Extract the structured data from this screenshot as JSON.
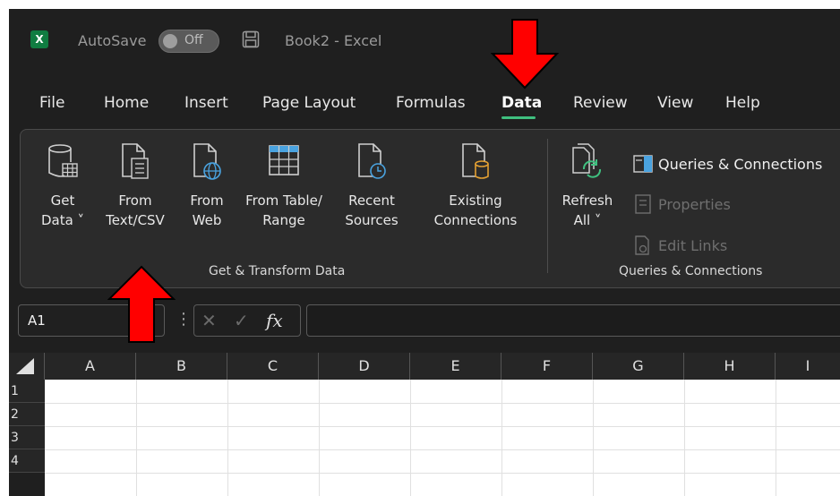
{
  "titlebar": {
    "logo": "X",
    "autosave_label": "AutoSave",
    "autosave_state": "Off",
    "save_icon": "save-icon",
    "doc_title": "Book2 - Excel"
  },
  "tabs": [
    {
      "label": "File"
    },
    {
      "label": "Home"
    },
    {
      "label": "Insert"
    },
    {
      "label": "Page Layout"
    },
    {
      "label": "Formulas"
    },
    {
      "label": "Data"
    },
    {
      "label": "Review"
    },
    {
      "label": "View"
    },
    {
      "label": "Help"
    }
  ],
  "active_tab": "Data",
  "ribbon": {
    "get_transform": {
      "group_label": "Get & Transform Data",
      "buttons": [
        {
          "line1": "Get",
          "line2": "Data ˅",
          "icon": "database-icon"
        },
        {
          "line1": "From",
          "line2": "Text/CSV",
          "icon": "text-file-icon"
        },
        {
          "line1": "From",
          "line2": "Web",
          "icon": "web-file-icon"
        },
        {
          "line1": "From Table/",
          "line2": "Range",
          "icon": "table-icon"
        },
        {
          "line1": "Recent",
          "line2": "Sources",
          "icon": "clock-file-icon"
        },
        {
          "line1": "Existing",
          "line2": "Connections",
          "icon": "connection-file-icon"
        }
      ]
    },
    "queries": {
      "group_label": "Queries & Connections",
      "refresh": {
        "line1": "Refresh",
        "line2": "All ˅",
        "icon": "refresh-icon"
      },
      "items": [
        {
          "label": "Queries & Connections",
          "enabled": true,
          "icon": "queries-panel-icon"
        },
        {
          "label": "Properties",
          "enabled": false,
          "icon": "properties-icon"
        },
        {
          "label": "Edit Links",
          "enabled": false,
          "icon": "edit-links-icon"
        }
      ]
    }
  },
  "formula_bar": {
    "name_box": "A1",
    "cancel": "✕",
    "enter": "✓",
    "fx": "fx",
    "formula": ""
  },
  "grid": {
    "columns": [
      "A",
      "B",
      "C",
      "D",
      "E",
      "F",
      "G",
      "H",
      "I"
    ],
    "rows": [
      "1",
      "2",
      "3",
      "4"
    ]
  },
  "colors": {
    "accent_underline": "#3fbf7f",
    "arrow": "#ff0000",
    "excel_green": "#107c41"
  }
}
